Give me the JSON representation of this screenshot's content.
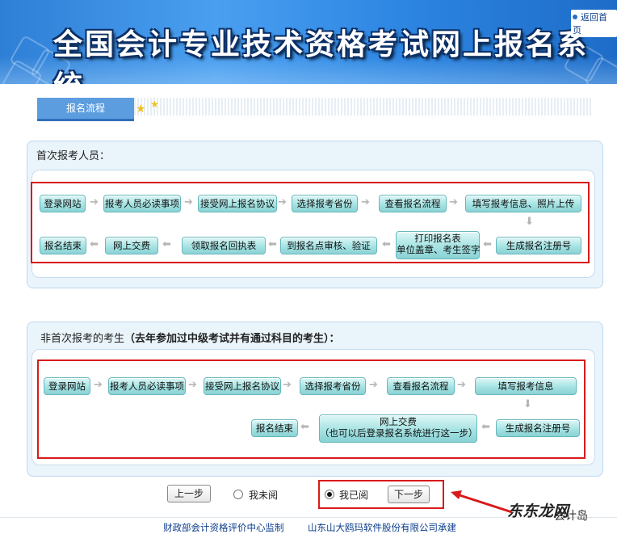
{
  "header": {
    "title": "全国会计专业技术资格考试网上报名系统",
    "back_link": "返回首页"
  },
  "section_tab": {
    "label": "报名流程"
  },
  "first_time": {
    "title": "首次报考人员：",
    "steps": [
      "登录网站",
      "报考人员必读事项",
      "接受网上报名协议",
      "选择报考省份",
      "查看报名流程",
      "填写报考信息、照片上传",
      "生成报名注册号",
      "打印报名表",
      "单位盖章、考生签字",
      "到报名点审核、验证",
      "领取报名回执表",
      "网上交费",
      "报名结束"
    ]
  },
  "repeat": {
    "title_plain": "非首次报考的考生",
    "title_bold": "（去年参加过中级考试并有通过科目的考生）：",
    "steps": [
      "登录网站",
      "报考人员必读事项",
      "接受网上报名协议",
      "选择报考省份",
      "查看报名流程",
      "填写报考信息",
      "生成报名注册号",
      "网上交费",
      "（也可以后登录报名系统进行这一步）",
      "报名结束"
    ]
  },
  "controls": {
    "prev": "上一步",
    "not_read": "我未阅",
    "read": "我已阅",
    "next": "下一步",
    "selected": "我已阅"
  },
  "footer": {
    "supervisor": "财政部会计资格评价中心监制",
    "builder": "山东山大鸥玛软件股份有限公司承建"
  },
  "watermark": {
    "main": "东东龙网",
    "tail": "会计岛"
  },
  "colors": {
    "accent_red": "#d81a1a",
    "step_teal": "#a6e3e3",
    "banner_blue": "#2e7fd6"
  }
}
